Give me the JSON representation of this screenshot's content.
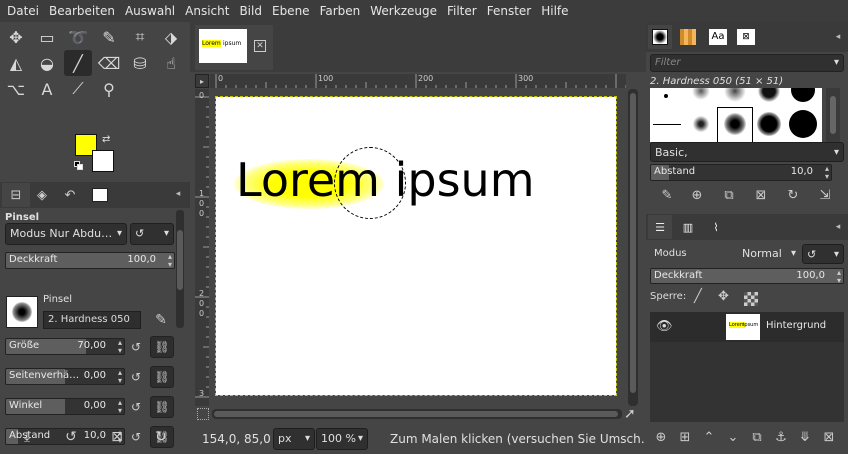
{
  "menubar": [
    "Datei",
    "Bearbeiten",
    "Auswahl",
    "Ansicht",
    "Bild",
    "Ebene",
    "Farben",
    "Werkzeuge",
    "Filter",
    "Fenster",
    "Hilfe"
  ],
  "toolbox": {
    "tools": [
      {
        "name": "move-tool-icon",
        "glyph": "✥"
      },
      {
        "name": "rect-select-icon",
        "glyph": "▭"
      },
      {
        "name": "lasso-icon",
        "glyph": "➰"
      },
      {
        "name": "fuzzy-select-icon",
        "glyph": "✎"
      },
      {
        "name": "crop-icon",
        "glyph": "⌗"
      },
      {
        "name": "transform-icon",
        "glyph": "⬗"
      },
      {
        "name": "warp-icon",
        "glyph": "◭"
      },
      {
        "name": "bucket-fill-icon",
        "glyph": "◒"
      },
      {
        "name": "paintbrush-icon",
        "glyph": "╱"
      },
      {
        "name": "eraser-icon",
        "glyph": "⌫"
      },
      {
        "name": "clone-icon",
        "glyph": "⛁"
      },
      {
        "name": "smudge-icon",
        "glyph": "☝"
      },
      {
        "name": "paths-icon",
        "glyph": "⌥"
      },
      {
        "name": "text-tool-icon",
        "glyph": "A"
      },
      {
        "name": "color-picker-icon",
        "glyph": "⟋"
      },
      {
        "name": "zoom-icon",
        "glyph": "⚲"
      }
    ],
    "fg_color": "#ffff00",
    "bg_color": "#ffffff"
  },
  "tooloptions": {
    "title": "Pinsel",
    "mode": "Modus Nur Abdu…",
    "opacity_label": "Deckkraft",
    "opacity_value": "100,0",
    "opacity_fraction": 1.0,
    "brush_label": "Pinsel",
    "brush_name": "2. Hardness 050",
    "size_label": "Größe",
    "size_value": "70,00",
    "size_fraction": 0.68,
    "aspect_label": "Seitenverhä…",
    "aspect_value": "0,00",
    "aspect_fraction": 0.5,
    "angle_label": "Winkel",
    "angle_value": "0,00",
    "angle_fraction": 0.5,
    "spacing_label": "Abstand",
    "spacing_value": "10,0",
    "spacing_fraction": 0.1
  },
  "image": {
    "tab_thumb_word1": "Lorem",
    "tab_thumb_word2": "ipsum",
    "ruler_h": [
      "0",
      "100",
      "200",
      "300"
    ],
    "ruler_v": [
      "0",
      "1",
      "0",
      "0",
      "2",
      "0",
      "0",
      "3"
    ],
    "canvas_text": "Lorem ipsum",
    "highlight_color": "#ffff00"
  },
  "status": {
    "coords": "154,0, 85,0",
    "unit": "px",
    "zoom": "100 %",
    "message": "Zum Malen klicken (versuchen Sie Umsch…"
  },
  "brushes": {
    "filter_placeholder": "Filter",
    "title": "2. Hardness 050 (51 × 51)",
    "tag": "Basic,",
    "spacing_label": "Abstand",
    "spacing_value": "10,0",
    "spacing_fraction": 0.1
  },
  "layers": {
    "mode_label": "Modus",
    "mode_value": "Normal",
    "opacity_label": "Deckkraft",
    "opacity_value": "100,0",
    "opacity_fraction": 1.0,
    "lock_label": "Sperre:",
    "layer_name": "Hintergrund"
  }
}
